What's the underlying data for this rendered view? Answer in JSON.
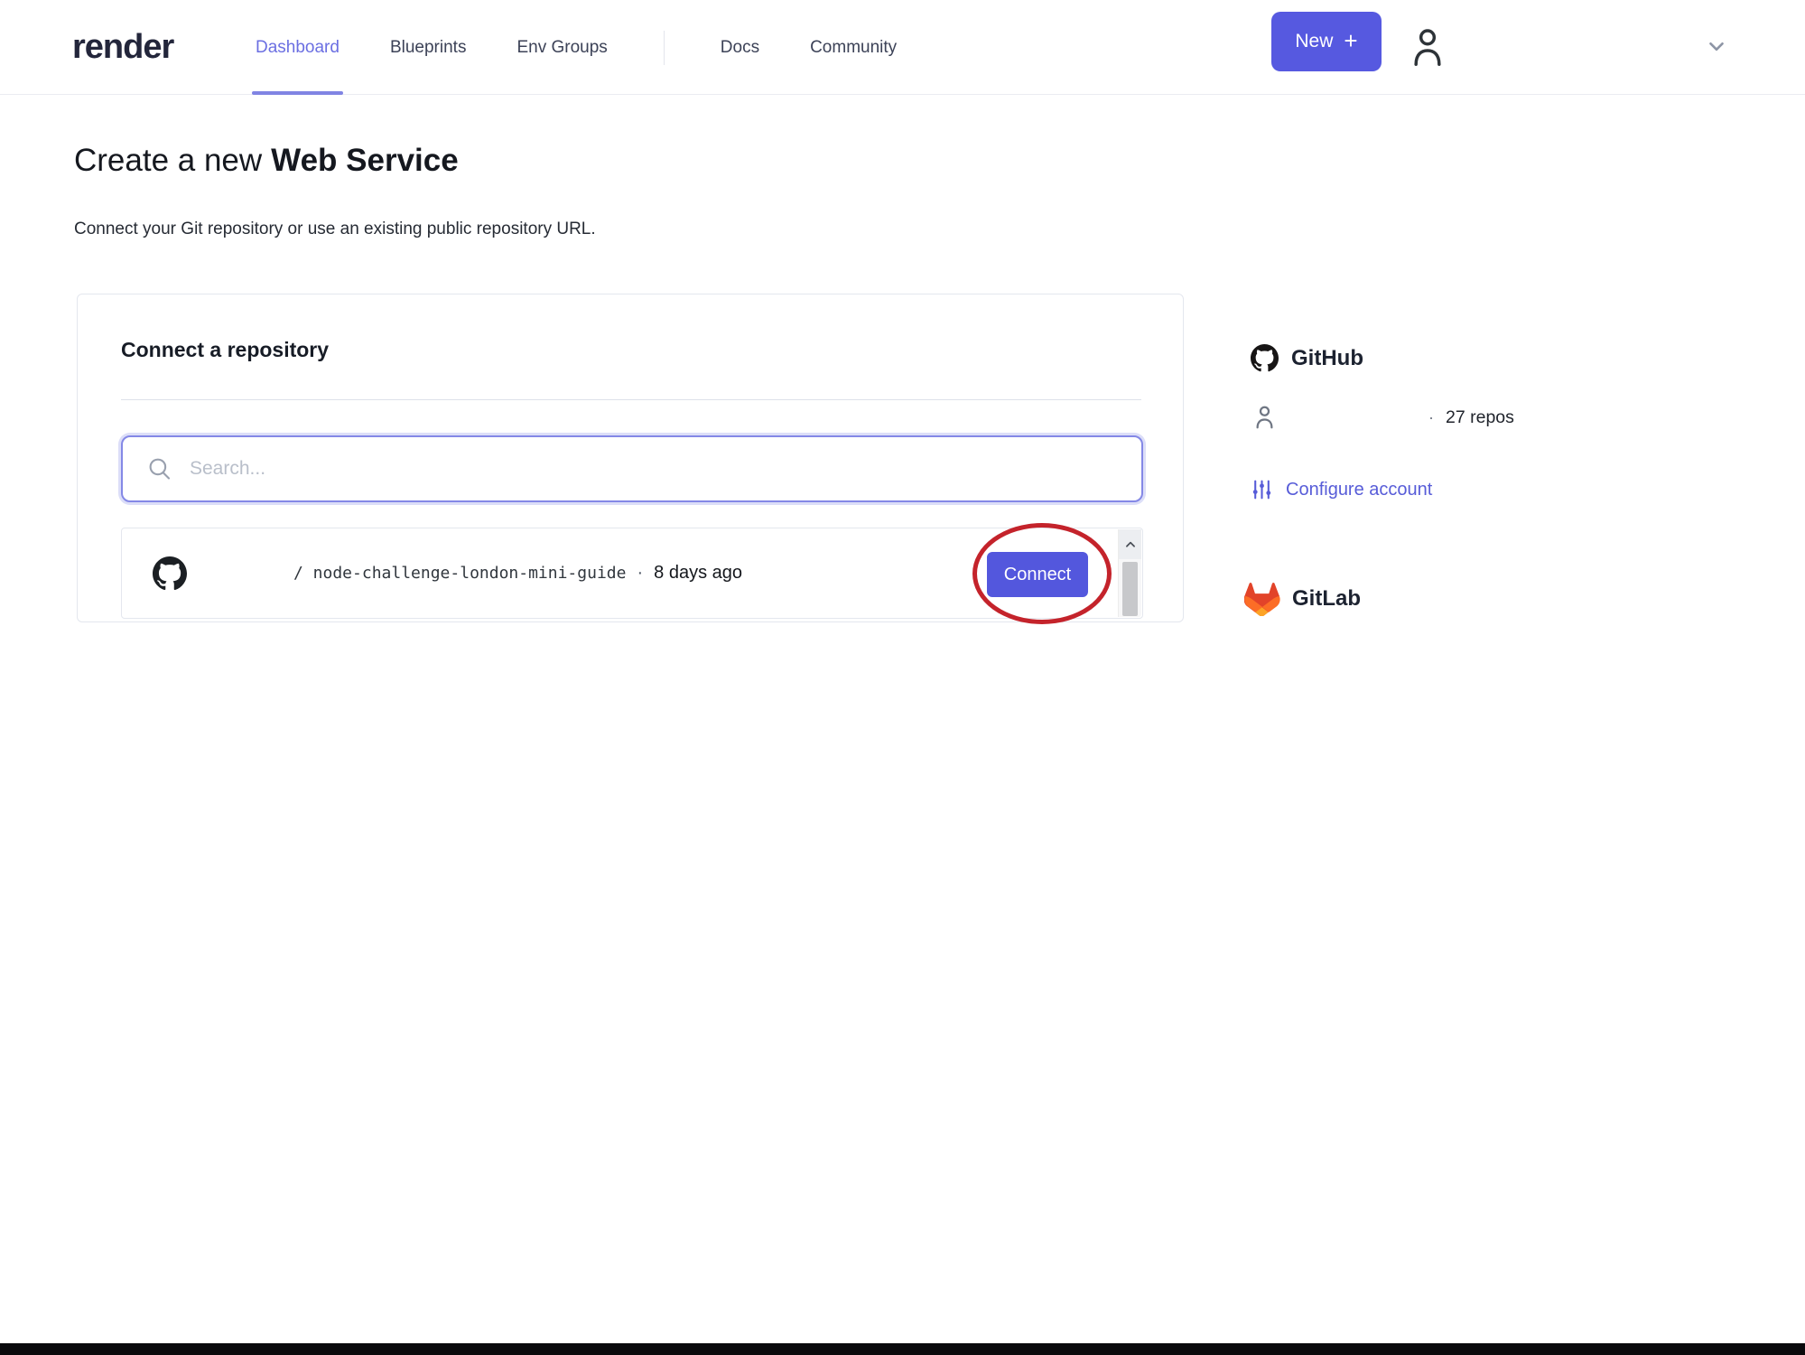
{
  "nav": {
    "logo": "render",
    "items": [
      {
        "label": "Dashboard",
        "active": true
      },
      {
        "label": "Blueprints",
        "active": false
      },
      {
        "label": "Env Groups",
        "active": false
      }
    ],
    "secondary_items": [
      {
        "label": "Docs"
      },
      {
        "label": "Community"
      }
    ],
    "new_button": {
      "label": "New",
      "plus": "+"
    }
  },
  "page": {
    "title_regular": "Create a new",
    "title_bold": "Web Service",
    "subtitle": "Connect your Git repository or use an existing public repository URL."
  },
  "connect_card": {
    "heading": "Connect a repository",
    "search": {
      "placeholder": "Search..."
    },
    "repo_row": {
      "path": "/ node-challenge-london-mini-guide",
      "separator": "·",
      "updated": "8 days ago",
      "connect_label": "Connect"
    }
  },
  "providers": {
    "github": {
      "title": "GitHub",
      "separator": "·",
      "repo_count": "27 repos",
      "configure_label": "Configure account"
    },
    "gitlab": {
      "title": "GitLab"
    }
  },
  "colors": {
    "accent_purple": "#5659e0",
    "connect_button": "#5357dd",
    "annotation_red": "#c4232b",
    "gitlab_red": "#e24329",
    "gitlab_orange": "#fc6d26",
    "gitlab_yellow": "#fca326"
  }
}
